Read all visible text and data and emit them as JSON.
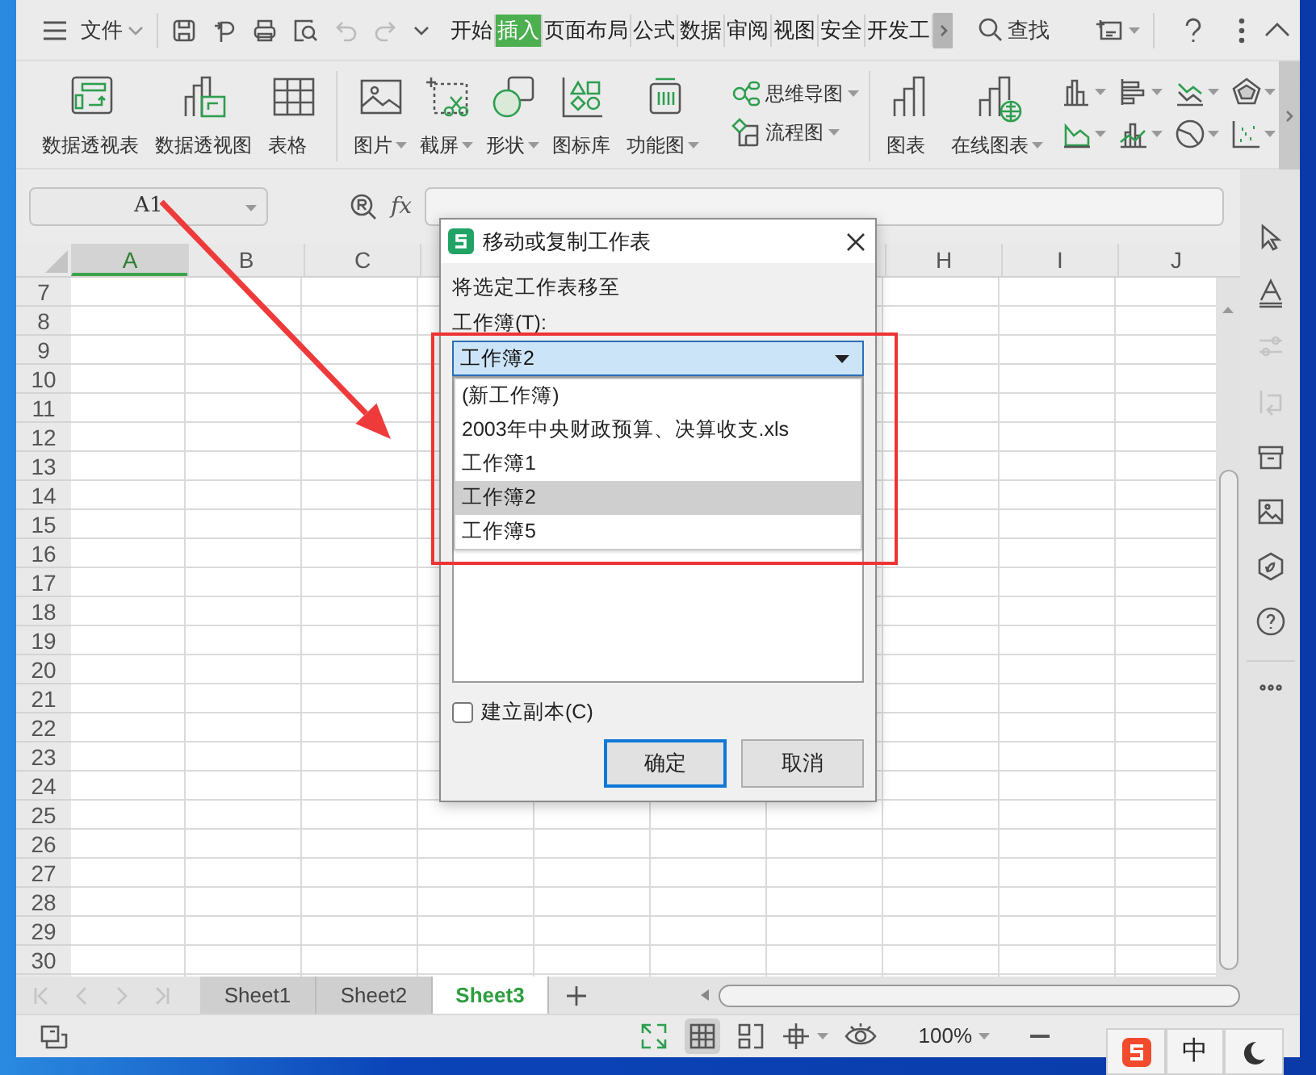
{
  "menu": {
    "file": "文件",
    "tabs": [
      {
        "label": "开始",
        "selected": false
      },
      {
        "label": "插入",
        "selected": true
      },
      {
        "label": "页面布局",
        "selected": false
      },
      {
        "label": "公式",
        "selected": false
      },
      {
        "label": "数据",
        "selected": false
      },
      {
        "label": "审阅",
        "selected": false
      },
      {
        "label": "视图",
        "selected": false
      },
      {
        "label": "安全",
        "selected": false
      },
      {
        "label": "开发工",
        "selected": false
      }
    ],
    "find": "查找"
  },
  "ribbon": {
    "large": [
      {
        "kind": "pivot-table",
        "label": "数据透视表",
        "dropdown": false
      },
      {
        "kind": "pivot-chart",
        "label": "数据透视图",
        "dropdown": false
      },
      {
        "kind": "table",
        "label": "表格",
        "dropdown": false
      },
      {
        "kind": "picture",
        "label": "图片",
        "dropdown": true
      },
      {
        "kind": "screenshot",
        "label": "截屏",
        "dropdown": true
      },
      {
        "kind": "shapes",
        "label": "形状",
        "dropdown": true
      },
      {
        "kind": "icons",
        "label": "图标库",
        "dropdown": false
      },
      {
        "kind": "function",
        "label": "功能图",
        "dropdown": true
      }
    ],
    "small": [
      {
        "kind": "mindmap",
        "label": "思维导图"
      },
      {
        "kind": "flowchart",
        "label": "流程图"
      }
    ],
    "charts": [
      {
        "kind": "chart",
        "label": "图表",
        "dropdown": false
      },
      {
        "kind": "online",
        "label": "在线图表",
        "dropdown": true
      }
    ]
  },
  "name_box": "A1",
  "formula_label": "fx",
  "columns": [
    {
      "label": "A",
      "selected": true
    },
    {
      "label": "B",
      "selected": false
    },
    {
      "label": "C",
      "selected": false
    },
    {
      "label": "H",
      "selected": false
    },
    {
      "label": "I",
      "selected": false
    },
    {
      "label": "J",
      "selected": false
    }
  ],
  "rows": [
    "7",
    "8",
    "9",
    "10",
    "11",
    "12",
    "13",
    "14",
    "15",
    "16",
    "17",
    "18",
    "19",
    "20",
    "21",
    "22",
    "23",
    "24",
    "25",
    "26",
    "27",
    "28",
    "29",
    "30"
  ],
  "sheets": [
    {
      "label": "Sheet1",
      "selected": false
    },
    {
      "label": "Sheet2",
      "selected": false
    },
    {
      "label": "Sheet3",
      "selected": true
    }
  ],
  "status": {
    "zoom": "100%"
  },
  "dialog": {
    "title": "移动或复制工作表",
    "prompt": "将选定工作表移至",
    "workbook_label": "工作簿(T):",
    "workbook_value": "工作簿2",
    "options": [
      {
        "label": "(新工作簿)",
        "selected": false
      },
      {
        "label": "2003年中央财政预算、决算收支.xls",
        "selected": false
      },
      {
        "label": "工作簿1",
        "selected": false
      },
      {
        "label": "工作簿2",
        "selected": true
      },
      {
        "label": "工作簿5",
        "selected": false
      }
    ],
    "copy_label": "建立副本(C)",
    "copy_checked": false,
    "buttons": [
      {
        "label": "确定",
        "default": true
      },
      {
        "label": "取消",
        "default": false
      }
    ]
  },
  "ime": {
    "mode": "中"
  }
}
